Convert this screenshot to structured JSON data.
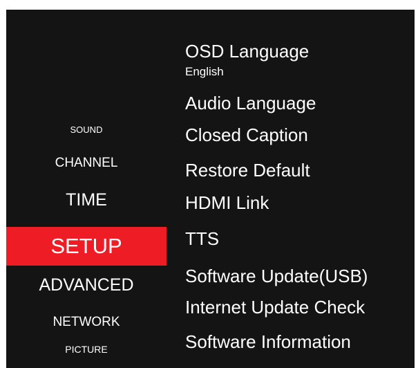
{
  "categories": {
    "sound": "SOUND",
    "channel": "CHANNEL",
    "time": "TIME",
    "setup": "SETUP",
    "advanced": "ADVANCED",
    "network": "NETWORK",
    "picture": "PICTURE"
  },
  "selected_category": "SETUP",
  "options": {
    "osd_language": {
      "label": "OSD Language",
      "value": "English"
    },
    "audio_language": "Audio Language",
    "closed_caption": "Closed Caption",
    "restore_default": "Restore Default",
    "hdmi_link": "HDMI Link",
    "tts": "TTS",
    "software_update_usb": "Software Update(USB)",
    "internet_update_check": "Internet Update Check",
    "software_information": "Software Information"
  },
  "colors": {
    "background": "#141414",
    "highlight": "#ee1c24",
    "text": "#ffffff"
  }
}
